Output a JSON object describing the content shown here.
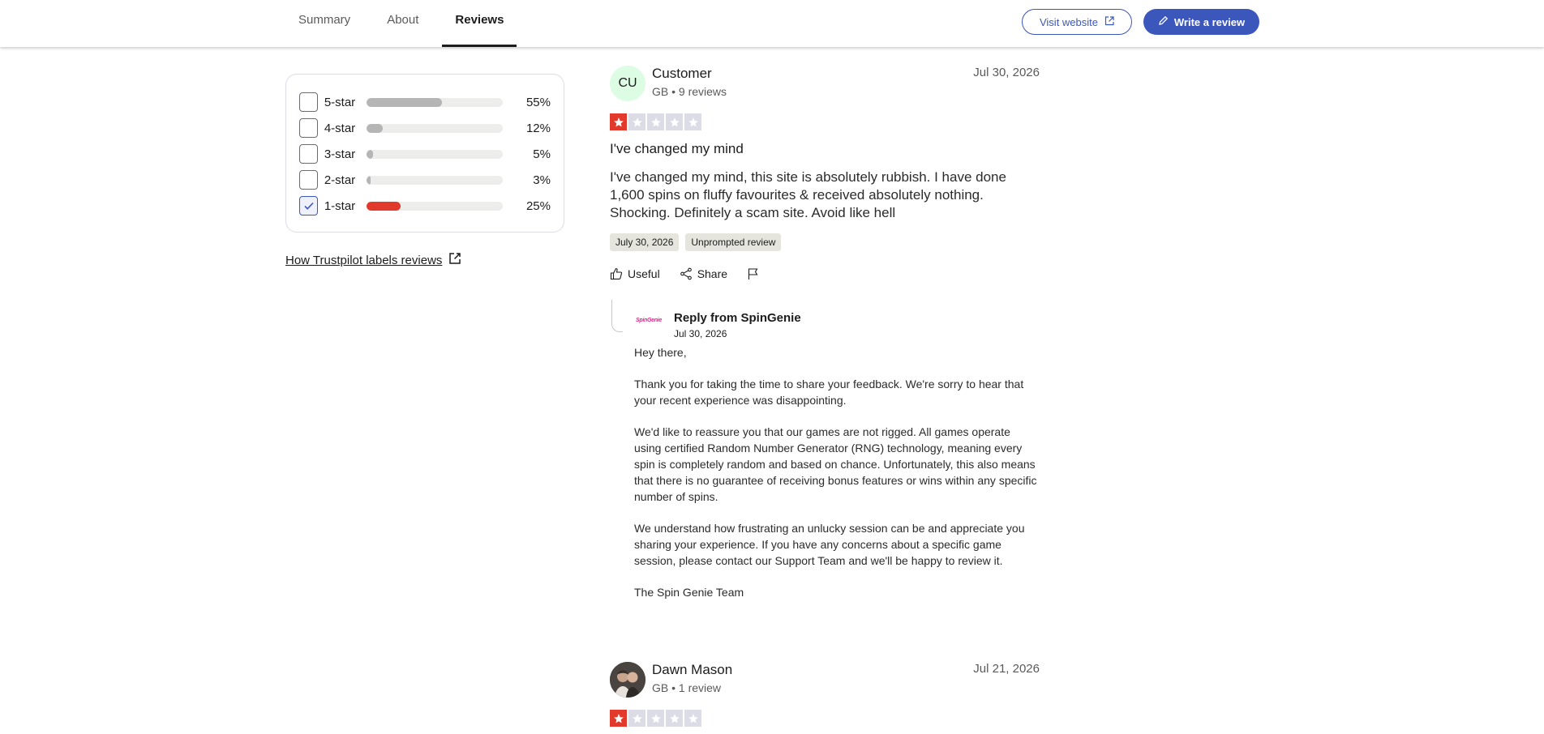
{
  "nav": {
    "tabs": [
      {
        "label": "Summary"
      },
      {
        "label": "About"
      },
      {
        "label": "Reviews"
      }
    ],
    "visit_label": "Visit website",
    "write_label": "Write a review"
  },
  "filters": {
    "rows": [
      {
        "label": "5-star",
        "pct_text": "55%",
        "fraction": 0.55,
        "checked": false
      },
      {
        "label": "4-star",
        "pct_text": "12%",
        "fraction": 0.12,
        "checked": false
      },
      {
        "label": "3-star",
        "pct_text": "5%",
        "fraction": 0.05,
        "checked": false
      },
      {
        "label": "2-star",
        "pct_text": "3%",
        "fraction": 0.03,
        "checked": false
      },
      {
        "label": "1-star",
        "pct_text": "25%",
        "fraction": 0.25,
        "checked": true
      }
    ],
    "labels_link": "How Trustpilot labels reviews"
  },
  "reviews": [
    {
      "avatar_initials": "CU",
      "name": "Customer",
      "meta": "GB • 9 reviews",
      "date": "Jul 30, 2026",
      "rating": 1,
      "title": "I've changed my mind",
      "body": "I've changed my mind, this site is absolutely rubbish. I have done 1,600 spins on fluffy favourites & received absolutely nothing. Shocking. Definitely a scam site. Avoid like hell",
      "chips": [
        "July 30, 2026",
        "Unprompted review"
      ],
      "actions": {
        "useful": "Useful",
        "share": "Share"
      },
      "reply": {
        "logo_text": "SpinGenie",
        "from": "Reply from SpinGenie",
        "date": "Jul 30, 2026",
        "paragraphs": [
          "Hey there,",
          "Thank you for taking the time to share your feedback. We're sorry to hear that your recent experience was disappointing.",
          "We'd like to reassure you that our games are not rigged. All games operate using certified Random Number Generator (RNG) technology, meaning every spin is completely random and based on chance. Unfortunately, this also means that there is no guarantee of receiving bonus features or wins within any specific number of spins.",
          "We understand how frustrating an unlucky session can be and appreciate you sharing your experience. If you have any concerns about a specific game session, please contact our Support Team and we'll be happy to review it.",
          "The Spin Genie Team"
        ]
      }
    },
    {
      "name": "Dawn Mason",
      "meta": "GB • 1 review",
      "date": "Jul 21, 2026",
      "rating": 1
    }
  ],
  "colors": {
    "accent": "#3c57bc",
    "star_on": "#e13a2c",
    "star_off": "#dcdce6",
    "bar_default": "#b5b5b5",
    "bar_selected": "#e13a2c"
  },
  "icons": [
    "external-link-icon",
    "pencil-icon",
    "check-icon",
    "star-icon",
    "thumbs-up-icon",
    "share-icon",
    "flag-icon"
  ]
}
